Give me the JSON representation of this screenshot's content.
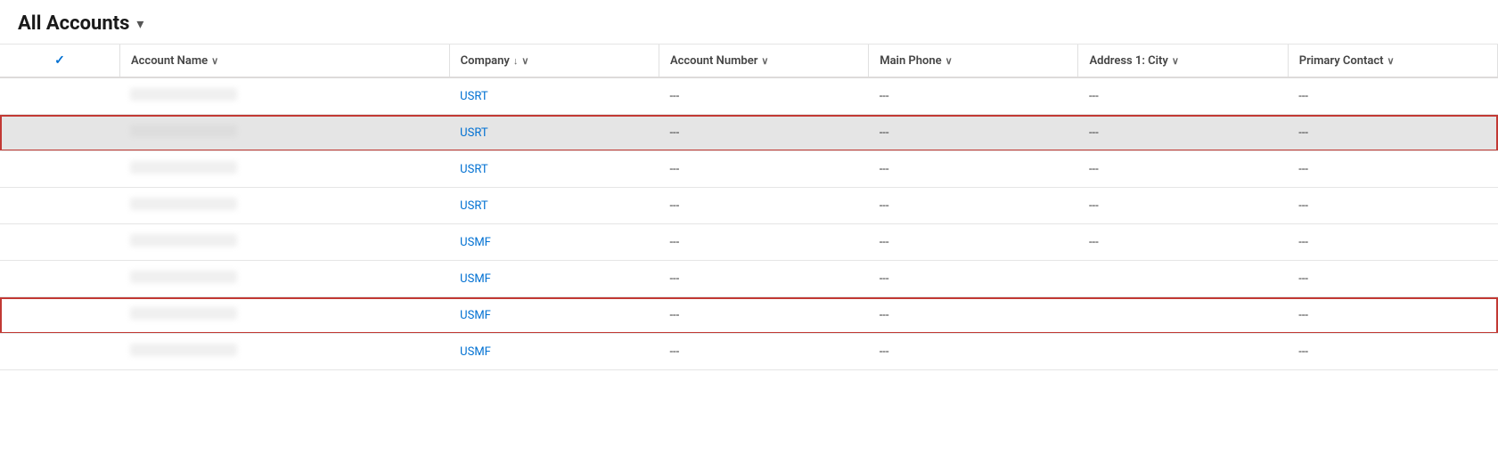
{
  "header": {
    "title": "All Accounts",
    "chevron": "▾"
  },
  "table": {
    "columns": [
      {
        "id": "check",
        "label": "✓",
        "sortable": false
      },
      {
        "id": "account-name",
        "label": "Account Name",
        "sortable": true,
        "sort_dir": null
      },
      {
        "id": "company",
        "label": "Company",
        "sortable": true,
        "sort_dir": "desc"
      },
      {
        "id": "account-number",
        "label": "Account Number",
        "sortable": true,
        "sort_dir": null
      },
      {
        "id": "main-phone",
        "label": "Main Phone",
        "sortable": true,
        "sort_dir": null
      },
      {
        "id": "address-city",
        "label": "Address 1: City",
        "sortable": true,
        "sort_dir": null
      },
      {
        "id": "primary-contact",
        "label": "Primary Contact",
        "sortable": true,
        "sort_dir": null
      }
    ],
    "rows": [
      {
        "id": 1,
        "account_name": "",
        "company": "USRT",
        "account_number": "---",
        "main_phone": "---",
        "address_city": "---",
        "primary_contact": "---",
        "state": "normal"
      },
      {
        "id": 2,
        "account_name": "",
        "company": "USRT",
        "account_number": "---",
        "main_phone": "---",
        "address_city": "---",
        "primary_contact": "---",
        "state": "highlighted"
      },
      {
        "id": 3,
        "account_name": "",
        "company": "USRT",
        "account_number": "---",
        "main_phone": "---",
        "address_city": "---",
        "primary_contact": "---",
        "state": "normal"
      },
      {
        "id": 4,
        "account_name": "",
        "company": "USRT",
        "account_number": "---",
        "main_phone": "---",
        "address_city": "---",
        "primary_contact": "---",
        "state": "normal"
      },
      {
        "id": 5,
        "account_name": "",
        "company": "USMF",
        "account_number": "---",
        "main_phone": "---",
        "address_city": "---",
        "primary_contact": "---",
        "state": "normal"
      },
      {
        "id": 6,
        "account_name": "",
        "company": "USMF",
        "account_number": "---",
        "main_phone": "---",
        "address_city": "",
        "primary_contact": "---",
        "state": "normal"
      },
      {
        "id": 7,
        "account_name": "",
        "company": "USMF",
        "account_number": "---",
        "main_phone": "---",
        "address_city": "",
        "primary_contact": "---",
        "state": "bordered"
      },
      {
        "id": 8,
        "account_name": "",
        "company": "USMF",
        "account_number": "---",
        "main_phone": "---",
        "address_city": "",
        "primary_contact": "---",
        "state": "normal"
      }
    ],
    "empty_value": "---"
  },
  "colors": {
    "link": "#0070d2",
    "border_red": "#c23934",
    "highlight_bg": "#e5e5e5",
    "header_border": "#dddbda"
  }
}
